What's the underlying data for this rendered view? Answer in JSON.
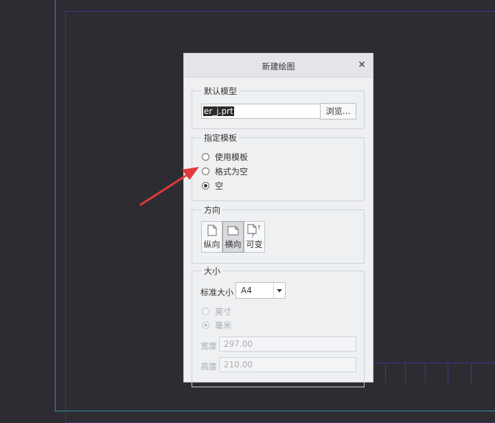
{
  "dialog": {
    "title": "新建绘图",
    "close_label": "×"
  },
  "default_model": {
    "legend": "默认模型",
    "value": "er_j.prt",
    "browse_label": "浏览..."
  },
  "template": {
    "legend": "指定模板",
    "options": [
      {
        "label": "使用模板",
        "checked": false
      },
      {
        "label": "格式为空",
        "checked": false
      },
      {
        "label": "空",
        "checked": true
      }
    ]
  },
  "orientation": {
    "legend": "方向",
    "options": [
      {
        "label": "纵向",
        "icon": "portrait-page-icon",
        "active": false
      },
      {
        "label": "横向",
        "icon": "landscape-page-icon",
        "active": true
      },
      {
        "label": "可变",
        "icon": "variable-page-icon",
        "active": false
      }
    ]
  },
  "size": {
    "legend": "大小",
    "standard_label": "标准大小",
    "standard_value": "A4",
    "units": [
      {
        "label": "英寸",
        "checked": false
      },
      {
        "label": "毫米",
        "checked": true
      }
    ],
    "width_label": "宽度",
    "width_value": "297.00",
    "height_label": "高度",
    "height_value": "210.00"
  },
  "colors": {
    "background": "#2d2c33",
    "sheet_border_outer": "#3a8fb0",
    "sheet_border_inner": "#3b3a8a",
    "dialog_bg": "#eef0f2",
    "annotation_arrow": "#e23a3a"
  }
}
